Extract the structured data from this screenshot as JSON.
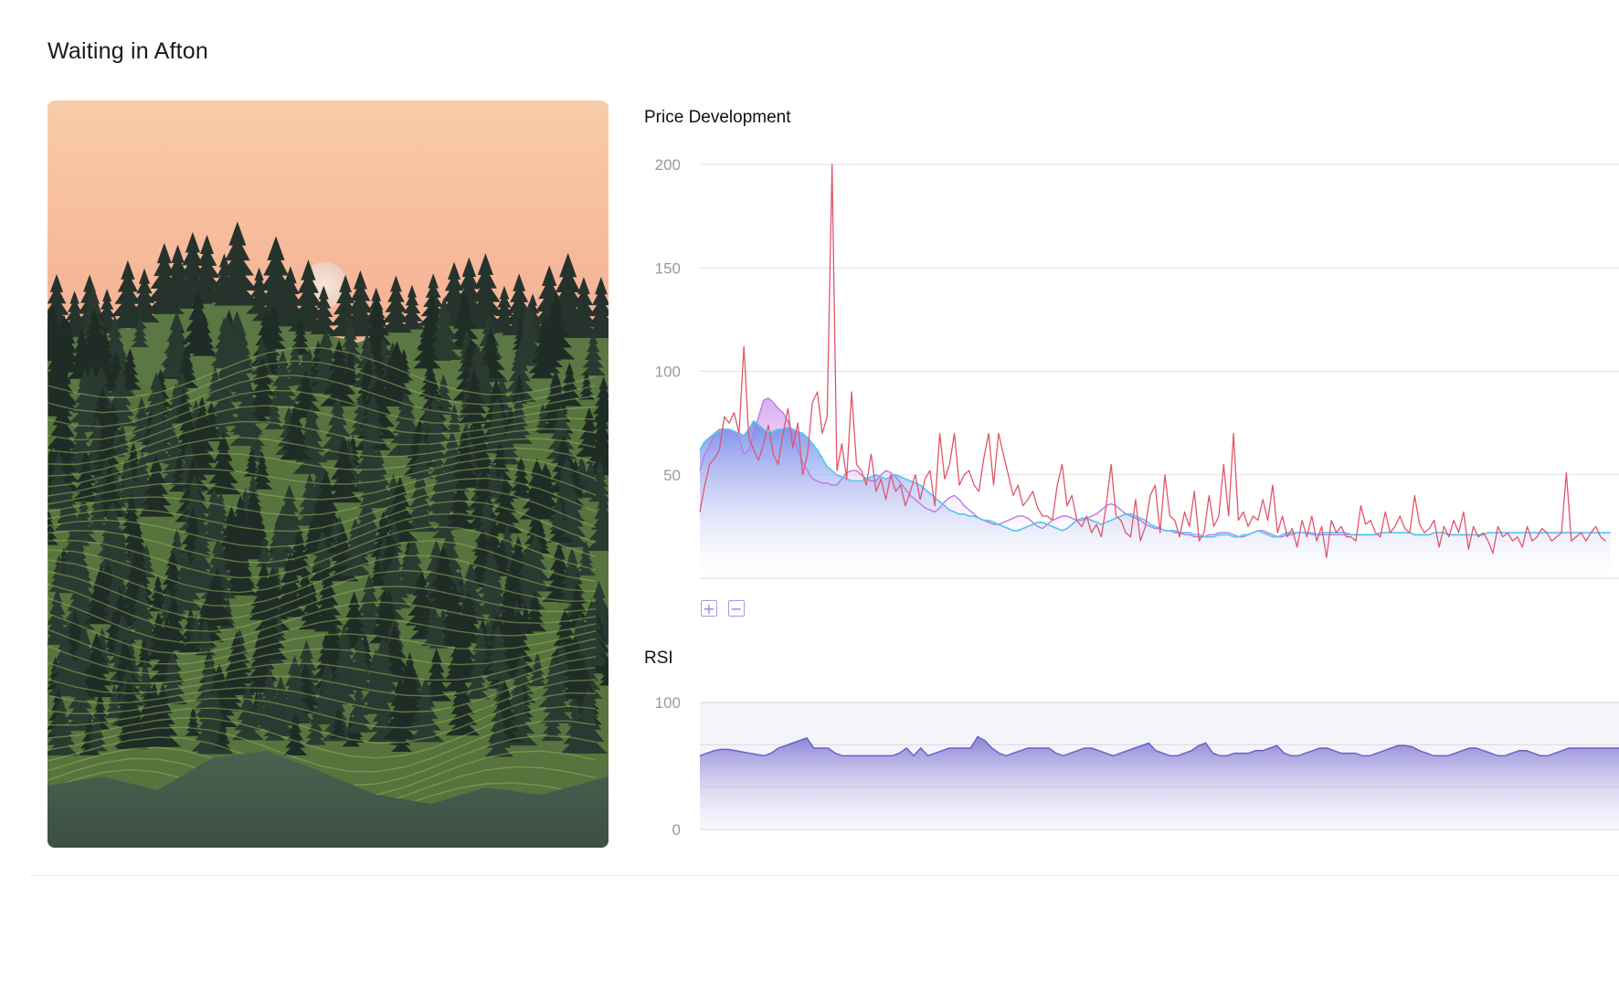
{
  "page": {
    "title": "Waiting in Afton"
  },
  "artwork": {
    "description_icon": "landscape-artwork",
    "colors": {
      "sky_top": "#f8ccaa",
      "sky_bottom": "#f4a88e",
      "moon": "#f3dcd0",
      "forest_dark": "#1f2f28",
      "forest_green": "#5c7a44",
      "ground": "#3f5446"
    }
  },
  "price_chart": {
    "title": "Price Development",
    "zoom_in_label": "+",
    "zoom_out_label": "−",
    "chart_data": {
      "type": "line",
      "title": "Price Development",
      "ylim": [
        0,
        200
      ],
      "y_ticks": [
        "200",
        "150",
        "100",
        "50"
      ],
      "grid": true,
      "series": [
        {
          "color": "#e0566b",
          "values": [
            32,
            45,
            55,
            58,
            62,
            78,
            75,
            80,
            70,
            112,
            68,
            62,
            57,
            65,
            74,
            60,
            55,
            70,
            82,
            63,
            75,
            50,
            60,
            85,
            90,
            70,
            78,
            200,
            52,
            65,
            48,
            90,
            55,
            52,
            45,
            60,
            42,
            48,
            38,
            50,
            42,
            45,
            35,
            42,
            50,
            38,
            48,
            52,
            35,
            70,
            48,
            55,
            70,
            45,
            50,
            52,
            45,
            42,
            58,
            70,
            45,
            70,
            60,
            50,
            40,
            45,
            35,
            38,
            42,
            34,
            30,
            30,
            28,
            45,
            55,
            35,
            40,
            28,
            25,
            30,
            22,
            26,
            20,
            35,
            55,
            30,
            28,
            22,
            20,
            38,
            18,
            25,
            40,
            45,
            22,
            50,
            30,
            28,
            20,
            32,
            25,
            42,
            18,
            22,
            40,
            25,
            30,
            55,
            30,
            70,
            28,
            32,
            25,
            30,
            28,
            38,
            28,
            45,
            22,
            30,
            20,
            24,
            15,
            28,
            20,
            30,
            18,
            25,
            10,
            28,
            22,
            25,
            20,
            20,
            18,
            35,
            26,
            28,
            22,
            20,
            32,
            22,
            25,
            30,
            24,
            22,
            40,
            26,
            22,
            24,
            28,
            15,
            25,
            20,
            28,
            22,
            32,
            14,
            25,
            20,
            22,
            18,
            12,
            25,
            20,
            22,
            18,
            20,
            15,
            25,
            18,
            20,
            24,
            22,
            18,
            20,
            22,
            51,
            18,
            20,
            22,
            18,
            22,
            25,
            20,
            18
          ],
          "x_range": [
            0,
            187
          ]
        },
        {
          "color": "#56c4ef",
          "values": [
            62,
            66,
            68,
            70,
            71,
            72,
            72,
            71,
            70,
            69,
            72,
            76,
            74,
            72,
            70,
            71,
            72,
            72,
            73,
            72,
            71,
            70,
            68,
            65,
            62,
            58,
            54,
            52,
            50,
            49,
            48,
            47,
            47,
            47,
            48,
            49,
            50,
            49,
            48,
            49,
            50,
            49,
            48,
            47,
            46,
            45,
            43,
            41,
            39,
            37,
            35,
            33,
            32,
            31,
            31,
            30,
            30,
            29,
            28,
            28,
            27,
            26,
            25,
            24,
            23,
            23,
            24,
            25,
            26,
            27,
            27,
            26,
            25,
            24,
            23,
            24,
            26,
            28,
            29,
            29,
            28,
            27,
            26,
            27,
            28,
            29,
            30,
            31,
            31,
            30,
            29,
            28,
            26,
            25,
            24,
            23,
            23,
            23,
            22,
            22,
            22,
            21,
            21,
            20,
            20,
            20,
            21,
            21,
            21,
            20,
            20,
            21,
            21,
            22,
            23,
            22,
            21,
            20,
            20,
            21,
            22,
            22,
            22,
            22,
            22,
            21,
            21,
            22,
            22,
            22,
            22,
            22,
            22,
            21,
            21,
            21,
            21,
            21,
            21,
            22,
            22,
            22,
            22,
            22,
            22,
            22,
            21,
            21,
            21,
            21,
            22,
            22,
            22,
            21,
            21,
            21,
            21,
            21,
            21,
            21,
            21,
            22,
            22,
            22,
            22,
            22,
            22,
            22,
            22,
            22,
            22,
            22,
            22,
            22,
            22,
            22,
            22,
            22,
            22,
            22,
            22,
            22,
            22,
            22,
            22,
            22,
            22
          ],
          "x_range": [
            0,
            187
          ]
        },
        {
          "color": "#b77be8",
          "values": [
            52,
            60,
            64,
            70,
            72,
            72,
            71,
            70,
            68,
            60,
            62,
            70,
            78,
            86,
            87,
            85,
            82,
            80,
            76,
            70,
            62,
            56,
            52,
            48,
            47,
            46,
            46,
            45,
            45,
            48,
            51,
            52,
            52,
            50,
            48,
            47,
            47,
            50,
            52,
            51,
            49,
            46,
            43,
            40,
            38,
            36,
            34,
            33,
            32,
            34,
            37,
            39,
            40,
            38,
            35,
            33,
            31,
            29,
            28,
            27,
            26,
            26,
            27,
            28,
            29,
            30,
            30,
            29,
            27,
            25,
            24,
            26,
            28,
            29,
            30,
            30,
            29,
            28,
            28,
            29,
            30,
            31,
            33,
            35,
            36,
            35,
            33,
            31,
            30,
            29,
            28,
            26,
            25,
            24,
            24,
            23,
            23,
            22,
            22,
            21,
            21,
            20,
            20,
            20,
            21,
            21,
            22,
            22,
            22,
            21,
            20,
            20,
            21,
            22,
            23,
            23,
            22,
            21,
            20,
            20,
            21,
            21,
            22,
            22,
            22,
            22,
            21,
            21,
            21,
            21,
            21,
            21,
            21,
            21,
            21,
            21,
            21,
            21,
            21,
            22,
            22,
            22,
            22,
            22,
            22,
            22,
            21,
            21,
            21,
            21,
            22,
            22,
            22,
            21,
            21,
            21,
            21,
            21,
            21,
            21,
            21,
            22,
            22,
            22,
            22,
            22,
            22,
            22,
            22,
            22,
            22,
            22,
            22,
            22,
            22,
            22,
            22,
            22,
            22,
            22,
            22,
            22,
            22,
            22,
            22,
            22,
            22
          ],
          "x_range": [
            0,
            187
          ]
        }
      ]
    }
  },
  "rsi_chart": {
    "title": "RSI",
    "chart_data": {
      "type": "area",
      "title": "RSI",
      "ylim": [
        0,
        100
      ],
      "y_ticks": [
        "100",
        "0"
      ],
      "grid": true,
      "series": [
        {
          "color": "#6b61c4",
          "values": [
            58,
            60,
            62,
            63,
            63,
            62,
            61,
            60,
            59,
            58,
            60,
            64,
            66,
            68,
            70,
            72,
            64,
            64,
            64,
            60,
            58,
            58,
            58,
            58,
            58,
            58,
            58,
            58,
            60,
            64,
            58,
            64,
            58,
            60,
            62,
            64,
            64,
            64,
            64,
            73,
            70,
            64,
            60,
            58,
            60,
            62,
            64,
            64,
            64,
            64,
            60,
            58,
            60,
            62,
            64,
            64,
            62,
            60,
            58,
            60,
            62,
            64,
            66,
            68,
            62,
            60,
            58,
            58,
            60,
            62,
            66,
            68,
            60,
            58,
            58,
            60,
            60,
            60,
            62,
            62,
            64,
            66,
            60,
            58,
            58,
            60,
            62,
            64,
            64,
            62,
            60,
            60,
            60,
            58,
            58,
            60,
            62,
            64,
            66,
            66,
            65,
            62,
            60,
            58,
            58,
            58,
            60,
            62,
            64,
            64,
            62,
            60,
            58,
            58,
            60,
            62,
            62,
            60,
            58,
            58,
            60,
            62,
            64,
            64,
            64,
            64,
            64,
            64,
            64,
            64
          ],
          "x_range": [
            0,
            129
          ]
        }
      ]
    }
  }
}
